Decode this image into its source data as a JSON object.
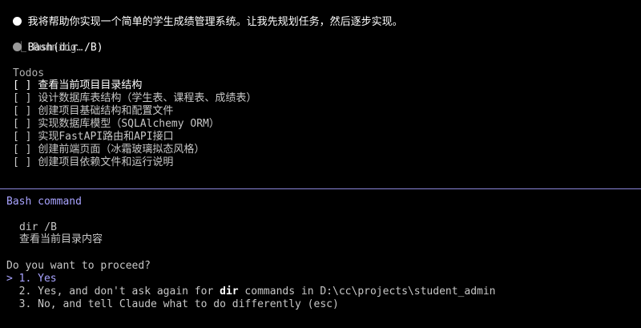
{
  "message": {
    "text": "我将帮助你实现一个简单的学生成绩管理系统。让我先规划任务，然后逐步实现。"
  },
  "tool": {
    "name": "Bash(dir /B)",
    "status": "⎿ Running…"
  },
  "todos": {
    "title": "Todos",
    "items": [
      {
        "checkbox": "[ ]",
        "label": "查看当前项目目录结构"
      },
      {
        "checkbox": "[ ]",
        "label": "设计数据库表结构（学生表、课程表、成绩表）"
      },
      {
        "checkbox": "[ ]",
        "label": "创建项目基础结构和配置文件"
      },
      {
        "checkbox": "[ ]",
        "label": "实现数据库模型（SQLAlchemy ORM）"
      },
      {
        "checkbox": "[ ]",
        "label": "实现FastAPI路由和API接口"
      },
      {
        "checkbox": "[ ]",
        "label": "创建前端页面（冰霜玻璃拟态风格）"
      },
      {
        "checkbox": "[ ]",
        "label": "创建项目依赖文件和运行说明"
      }
    ]
  },
  "prompt": {
    "title": "Bash command",
    "command": "dir /B",
    "description": "查看当前目录内容",
    "question": "Do you want to proceed?",
    "cursor": ">",
    "options": [
      {
        "number": "1.",
        "pre": "Yes",
        "bold": "",
        "post": ""
      },
      {
        "number": "2.",
        "pre": "Yes, and don't ask again for ",
        "bold": "dir",
        "post": " commands in D:\\cc\\projects\\student_admin"
      },
      {
        "number": "3.",
        "pre": "No, and tell Claude what to do differently (esc)",
        "bold": "",
        "post": ""
      }
    ]
  },
  "colors": {
    "background": "#000000",
    "text": "#c7c7c7",
    "accent": "#a8a3ff",
    "dot_done": "#ffffff",
    "dot_running": "#9a9a9a"
  }
}
